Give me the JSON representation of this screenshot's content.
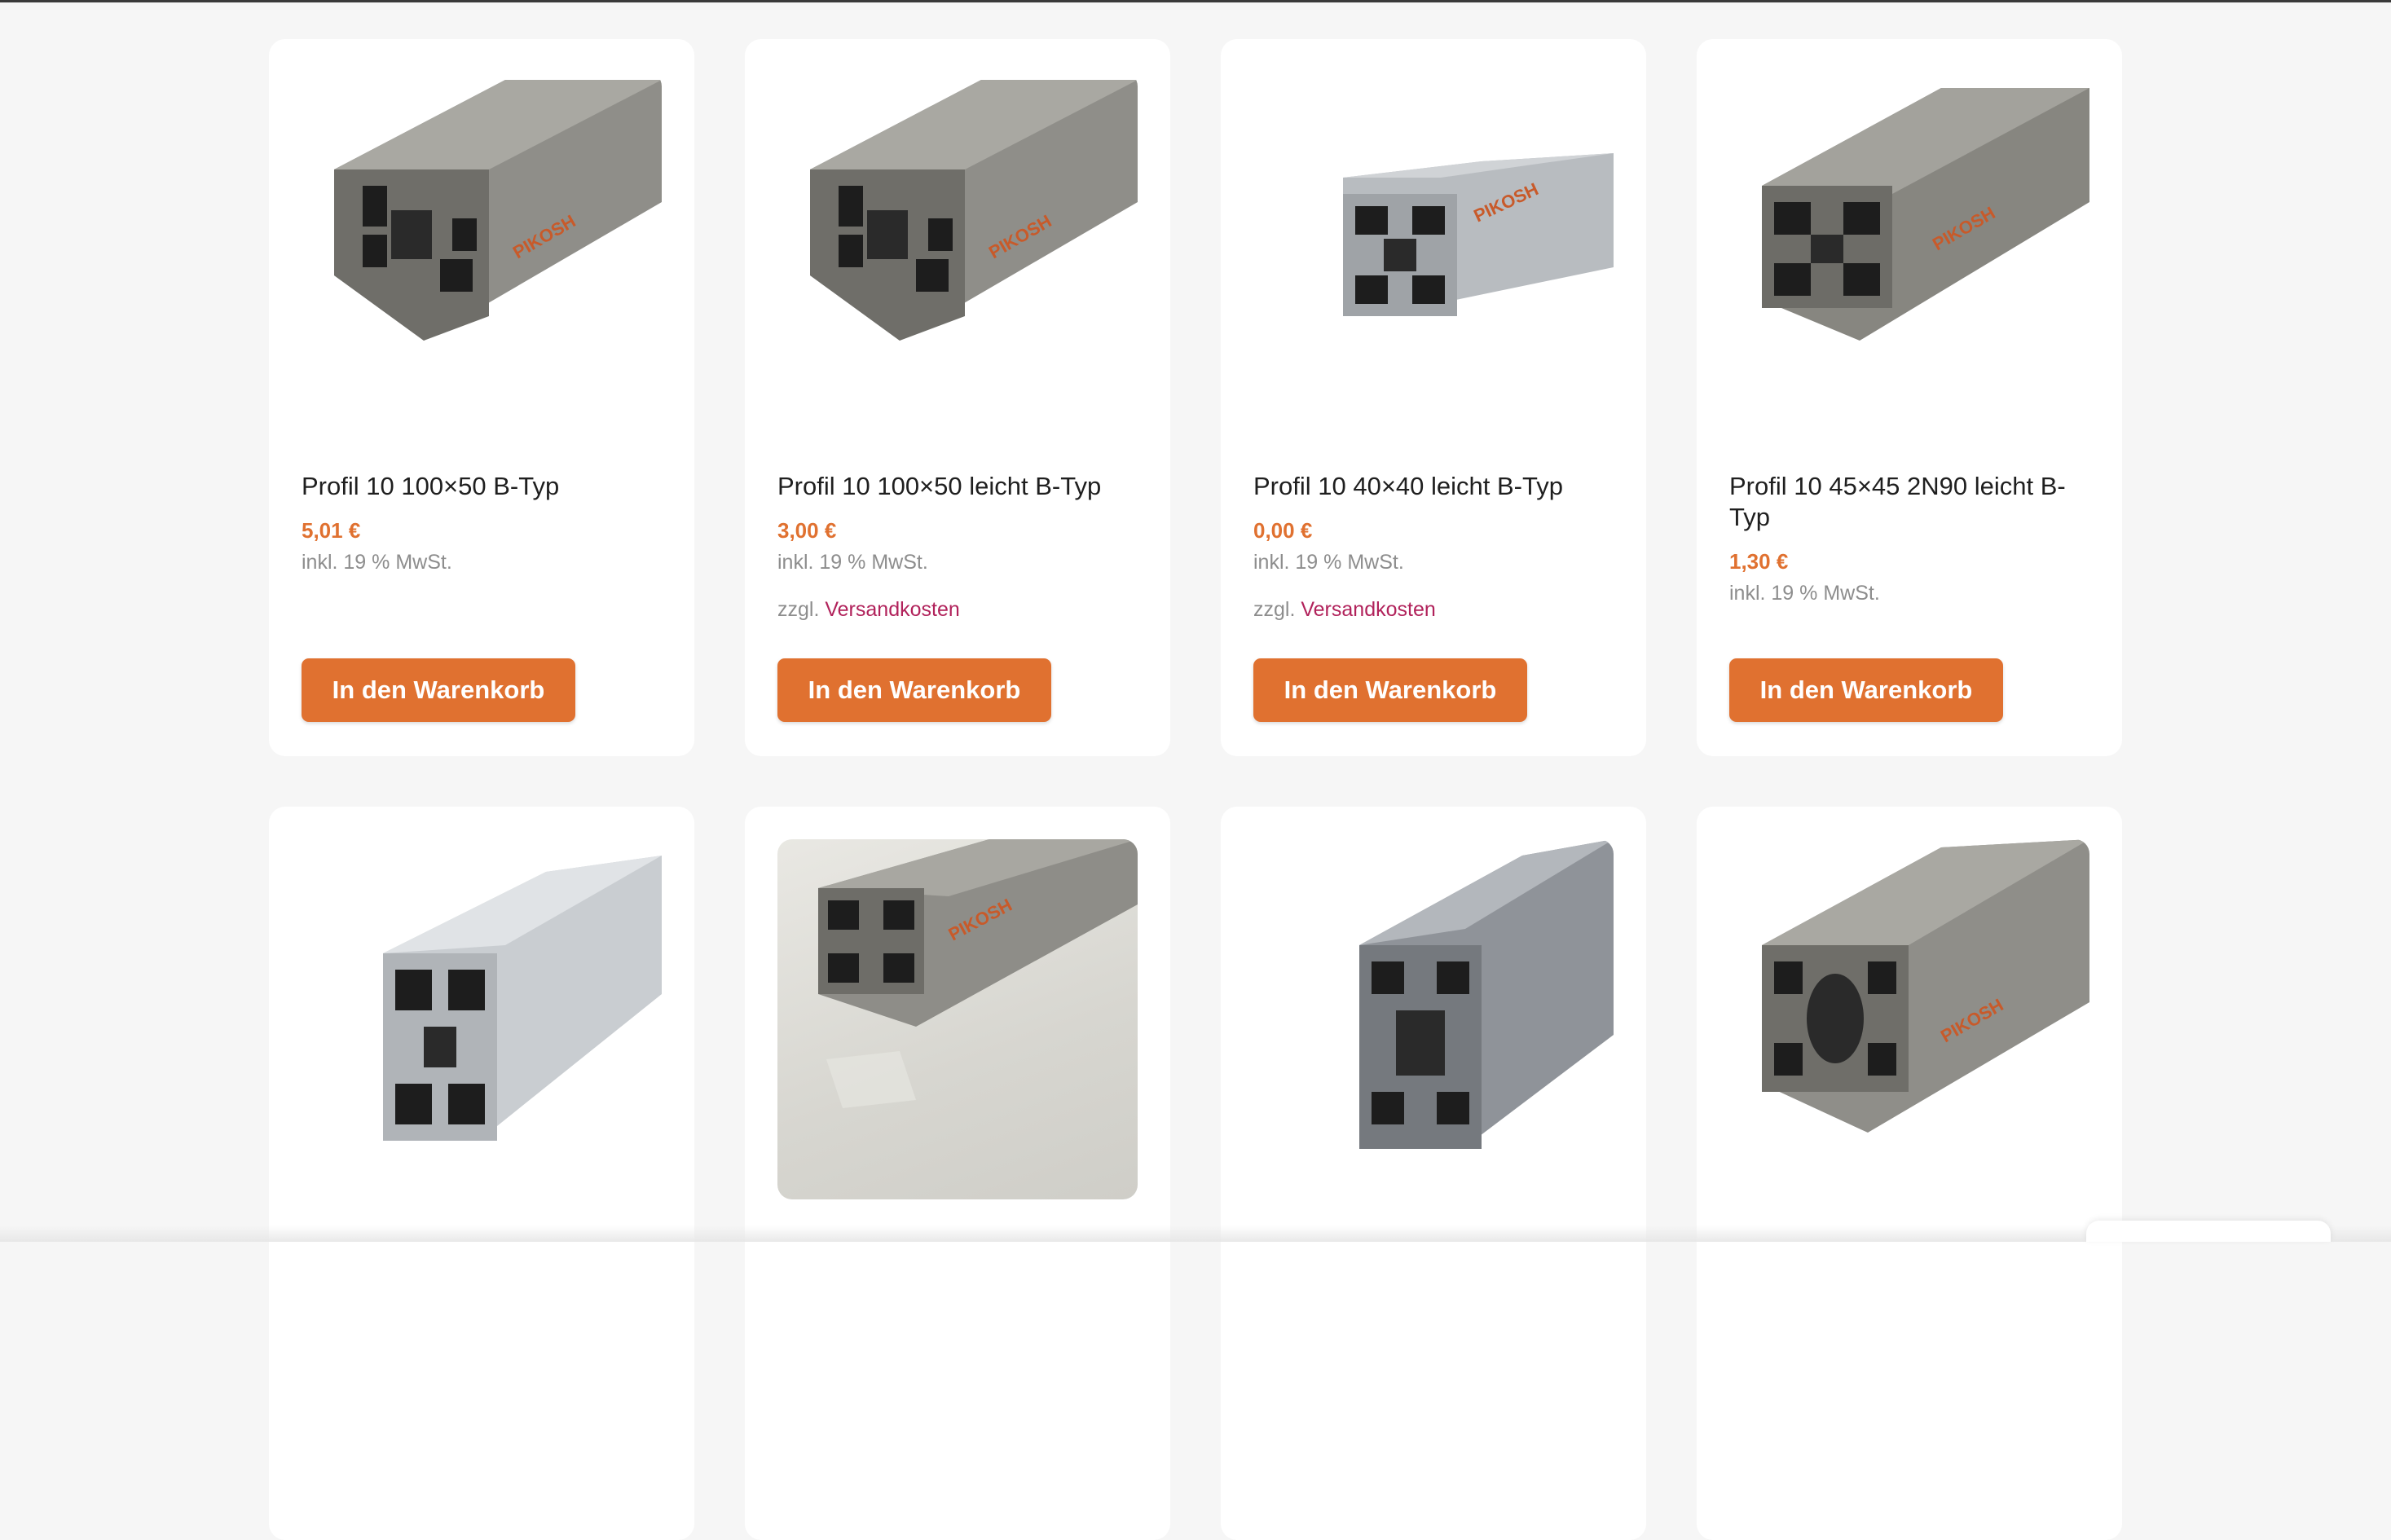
{
  "products": [
    {
      "title": "Profil 10 100×50 B-Typ",
      "price": "5,01 €",
      "tax": "inkl. 19 % MwSt.",
      "shipping_prefix": "",
      "shipping_link": "",
      "button": "In den Warenkorb",
      "image": "aluminium-profile-100x50-image"
    },
    {
      "title": "Profil 10 100×50 leicht B-Typ",
      "price": "3,00 €",
      "tax": "inkl. 19 % MwSt.",
      "shipping_prefix": "zzgl.",
      "shipping_link": "Versandkosten",
      "button": "In den Warenkorb",
      "image": "aluminium-profile-100x50-light-image"
    },
    {
      "title": "Profil 10 40×40 leicht B-Typ",
      "price": "0,00 €",
      "tax": "inkl. 19 % MwSt.",
      "shipping_prefix": "zzgl.",
      "shipping_link": "Versandkosten",
      "button": "In den Warenkorb",
      "image": "aluminium-profile-40x40-image"
    },
    {
      "title": "Profil 10 45×45 2N90 leicht B-Typ",
      "price": "1,30 €",
      "tax": "inkl. 19 % MwSt.",
      "shipping_prefix": "",
      "shipping_link": "",
      "button": "In den Warenkorb",
      "image": "aluminium-profile-45x45-image"
    },
    {
      "image": "aluminium-profile-silver-image"
    },
    {
      "image": "aluminium-profile-on-table-image"
    },
    {
      "image": "aluminium-profile-80x40-image"
    },
    {
      "image": "aluminium-profile-oval-core-image"
    }
  ],
  "colors": {
    "accent": "#e07130",
    "link": "#b1225b",
    "background": "#f6f6f6"
  }
}
